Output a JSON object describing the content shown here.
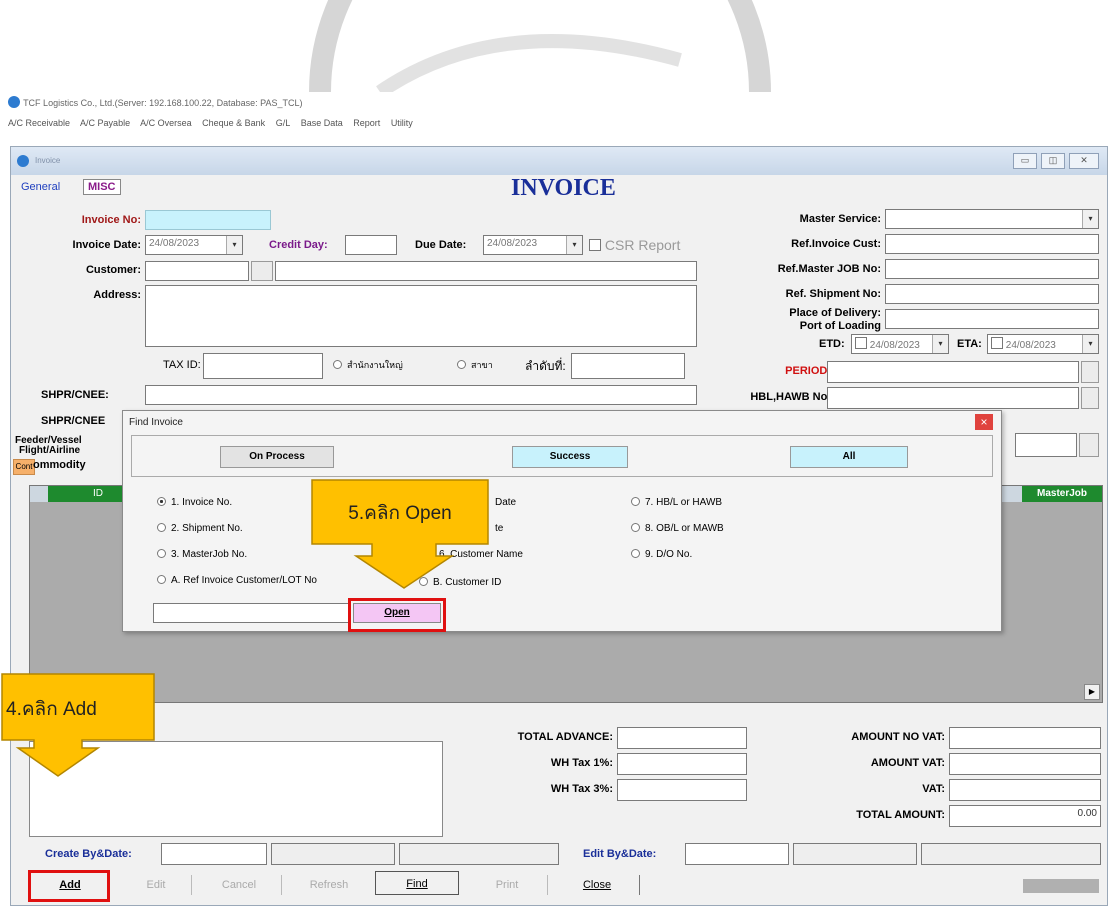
{
  "app": {
    "title": "TCF Logistics Co., Ltd.(Server: 192.168.100.22, Database: PAS_TCL)",
    "menu": [
      "A/C Receivable",
      "A/C Payable",
      "A/C Oversea",
      "Cheque & Bank",
      "G/L",
      "Base Data",
      "Report",
      "Utility"
    ]
  },
  "window": {
    "title": "Invoice"
  },
  "tabs": [
    "General",
    "MISC"
  ],
  "form": {
    "heading": "INVOICE",
    "invoice_no_label": "Invoice No:",
    "invoice_date_label": "Invoice Date:",
    "invoice_date_value": "24/08/2023",
    "credit_day_label": "Credit Day:",
    "due_date_label": "Due Date:",
    "due_date_value": "24/08/2023",
    "csr_report_label": "CSR Report",
    "customer_label": "Customer:",
    "address_label": "Address:",
    "tax_id_label": "TAX ID:",
    "head_office_label": "สำนักงานใหญ่",
    "branch_label": "สาขา",
    "branch_no_label": "ลำดับที่:",
    "shpr_cnee_label": "SHPR/CNEE:",
    "shpr_cnee2_label": "SHPR/CNEE",
    "feeder_label": "Feeder/Vessel",
    "flight_label": "Flight/Airline",
    "cont_label": "Cont",
    "commodity_label": "ommodity",
    "master_service_label": "Master Service:",
    "ref_invoice_cust_label": "Ref.Invoice Cust:",
    "ref_master_job_label": "Ref.Master JOB No:",
    "ref_shipment_label": "Ref. Shipment No:",
    "place_of_delivery_label": "Place of Delivery:",
    "port_of_loading_label": "Port of Loading",
    "etd_label": "ETD:",
    "etd_value": "24/08/2023",
    "eta_label": "ETA:",
    "eta_value": "24/08/2023",
    "period_label": "PERIOD:",
    "hbl_label": "HBL,HAWB No:"
  },
  "grid": {
    "col_id": "ID",
    "col_masterjob": "MasterJob"
  },
  "totals": {
    "total_advance": "TOTAL ADVANCE:",
    "wh_tax_1": "WH Tax 1%:",
    "wh_tax_3": "WH Tax 3%:",
    "amount_no_vat": "AMOUNT NO VAT:",
    "amount_vat": "AMOUNT VAT:",
    "vat": "VAT:",
    "total_amount": "TOTAL AMOUNT:",
    "total_amount_value": "0.00"
  },
  "audit": {
    "create_label": "Create By&Date:",
    "edit_label": "Edit By&Date:"
  },
  "toolbar": [
    "Add",
    "Edit",
    "Cancel",
    "Refresh",
    "Find",
    "Print",
    "Close"
  ],
  "dialog": {
    "title": "Find Invoice",
    "tabs": [
      "On Process",
      "Success",
      "All"
    ],
    "options": [
      {
        "label": "1. Invoice No.",
        "selected": true
      },
      {
        "label": "Date",
        "selected": false
      },
      {
        "label": "7. HB/L or HAWB",
        "selected": false
      },
      {
        "label": "2. Shipment No.",
        "selected": false
      },
      {
        "label": "te",
        "selected": false
      },
      {
        "label": "8. OB/L or MAWB",
        "selected": false
      },
      {
        "label": "3. MasterJob No.",
        "selected": false
      },
      {
        "label": "6. Customer Name",
        "selected": false
      },
      {
        "label": "9. D/O No.",
        "selected": false
      },
      {
        "label": "A. Ref Invoice Customer/LOT No",
        "selected": false
      },
      {
        "label": "B. Customer ID",
        "selected": false
      }
    ],
    "open_label": "Open",
    "close_glyph": "×"
  },
  "callouts": {
    "open": "5.คลิก Open",
    "add": "4.คลิก Add"
  },
  "colors": {
    "accent_red": "#e01010",
    "callout": "#ffc000",
    "grid_header": "#1e8a2e",
    "invoice_no_field": "#c8f2fc",
    "open_button": "#f4c6f4"
  }
}
